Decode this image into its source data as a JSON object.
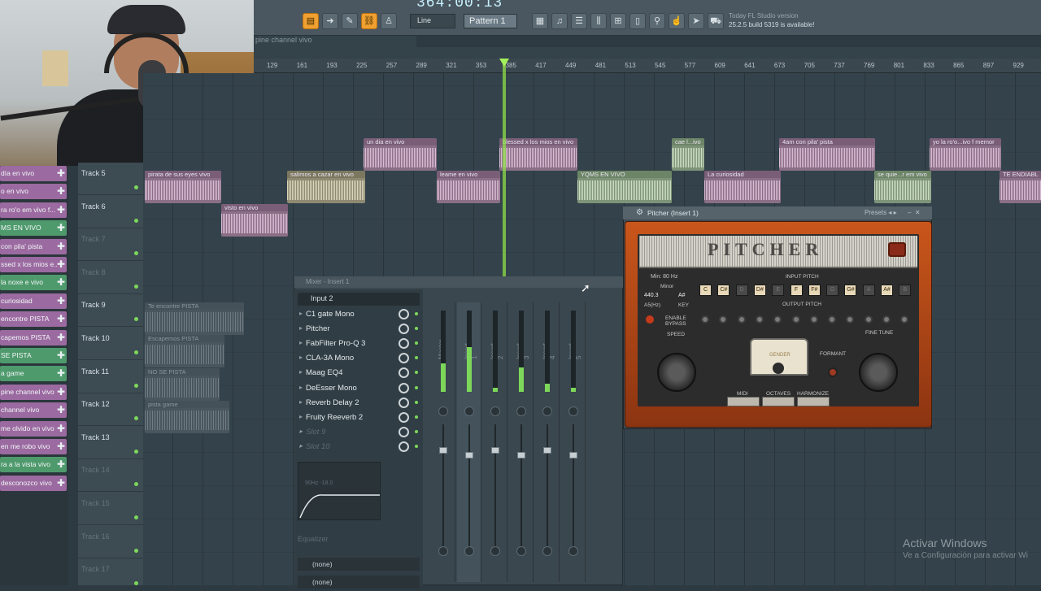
{
  "toolbar": {
    "time_display": "364:00:13",
    "snap_mode": "Line",
    "pattern": "Pattern 1",
    "news_line1": "Today  FL Studio version",
    "news_line2": "25.2.5 build 5319 is available!"
  },
  "breadcrumb": "pine channel vivo",
  "ruler": {
    "ticks": [
      "129",
      "161",
      "193",
      "225",
      "257",
      "289",
      "321",
      "353",
      "385",
      "417",
      "449",
      "481",
      "513",
      "545",
      "577",
      "609",
      "641",
      "673",
      "705",
      "737",
      "769",
      "801",
      "833",
      "865",
      "897",
      "929"
    ]
  },
  "picker": {
    "items": [
      {
        "label": "día en vivo",
        "color": "#9b6aa0"
      },
      {
        "label": "o en vivo",
        "color": "#9b6aa0"
      },
      {
        "label": "ra ro'o em vivo f...",
        "color": "#9b6aa0"
      },
      {
        "label": "MS EN VIVO",
        "color": "#4f9a6c"
      },
      {
        "label": "con pila' pista",
        "color": "#9b6aa0"
      },
      {
        "label": "ssed x los mios e..",
        "color": "#9b6aa0"
      },
      {
        "label": "la noxe e vivo",
        "color": "#4f9a6c"
      },
      {
        "label": "curiosidad",
        "color": "#9b6aa0"
      },
      {
        "label": "encontre PISTA",
        "color": "#9b6aa0"
      },
      {
        "label": "capemos PISTA",
        "color": "#9b6aa0"
      },
      {
        "label": "SE PISTA",
        "color": "#4f9a6c"
      },
      {
        "label": "a game",
        "color": "#4f9a6c"
      },
      {
        "label": "pine channel vivo",
        "color": "#9b6aa0"
      },
      {
        "label": "channel vivo",
        "color": "#9b6aa0"
      },
      {
        "label": "me olvido en vivo",
        "color": "#9b6aa0"
      },
      {
        "label": "en me robo vivo",
        "color": "#9b6aa0"
      },
      {
        "label": "ra a la vista vivo",
        "color": "#4f9a6c"
      },
      {
        "label": "desconozco vivo",
        "color": "#9b6aa0"
      }
    ]
  },
  "tracks": [
    {
      "name": "Track 5",
      "dim": false
    },
    {
      "name": "Track 6",
      "dim": false
    },
    {
      "name": "Track 7",
      "dim": true
    },
    {
      "name": "Track 8",
      "dim": true
    },
    {
      "name": "Track 9",
      "dim": false
    },
    {
      "name": "Track 10",
      "dim": false
    },
    {
      "name": "Track 11",
      "dim": false
    },
    {
      "name": "Track 12",
      "dim": false
    },
    {
      "name": "Track 13",
      "dim": false
    },
    {
      "name": "Track 14",
      "dim": true
    },
    {
      "name": "Track 15",
      "dim": true
    },
    {
      "name": "Track 16",
      "dim": true
    },
    {
      "name": "Track 17",
      "dim": true
    }
  ],
  "clips": {
    "c1": "un dia en vivo",
    "c2": "blessed x los mios en vivo",
    "c3": "cae l...ivo",
    "c4": "4am con pila' pista",
    "c5": "yo la ro'o...ivo f memor",
    "c6": "pirata de sus eyes vivo",
    "c7": "salimos a cazar en vivo",
    "c8": "leame en vivo",
    "c9": "YQMS EN VIVO",
    "c10": "La curiosidad",
    "c11": "se quie...r em vivo",
    "c12": "TE ENDIABL",
    "c13": "visto en vivo",
    "c14": "Te encontre PISTA",
    "c15": "Escapemos PISTA",
    "c16": "NO SE PISTA",
    "c17": "pista game"
  },
  "mixer": {
    "title": "Mixer - Insert 1",
    "input": "Input 2",
    "slots": [
      "C1 gate Mono",
      "Pitcher",
      "FabFilter Pro-Q 3",
      "CLA-3A Mono",
      "Maag EQ4",
      "DeEsser Mono",
      "Reverb Delay 2",
      "Fruity Reeverb 2",
      "Slot 9",
      "Slot 10"
    ],
    "eq_label": "Equalizer",
    "eq_readout": "90Hz -18.0",
    "sends": [
      "(none)",
      "(none)"
    ],
    "strips": [
      "Master",
      "Insert 1",
      "Insert 2",
      "Insert 3",
      "Insert 4",
      "Insert 5"
    ]
  },
  "pitcher": {
    "title": "Pitcher (Insert 1)",
    "presets_label": "Presets",
    "logo": "PITCHER",
    "min_label": "Min: 80 Hz",
    "scale": "Minor",
    "ref": "440.3",
    "key": "A#",
    "input_pitch": "INPUT PITCH",
    "output_pitch": "OUTPUT PITCH",
    "a5": "A5(Hz)",
    "key_label": "KEY",
    "enable_bypass": "ENABLE BYPASS",
    "speed": "SPEED",
    "gender": "GENDER",
    "formant": "FORMANT",
    "fine_tune": "FINE TUNE",
    "modes": [
      "MIDI",
      "OCTAVES",
      "HARMONIZE"
    ],
    "notes": [
      "C",
      "C#",
      "D",
      "D#",
      "E",
      "F",
      "F#",
      "G",
      "G#",
      "A",
      "A#",
      "B"
    ],
    "active_notes": [
      0,
      1,
      3,
      5,
      6,
      8,
      10
    ]
  },
  "watermark": {
    "title": "Activar Windows",
    "subtitle": "Ve a Configuración para activar Wi"
  }
}
